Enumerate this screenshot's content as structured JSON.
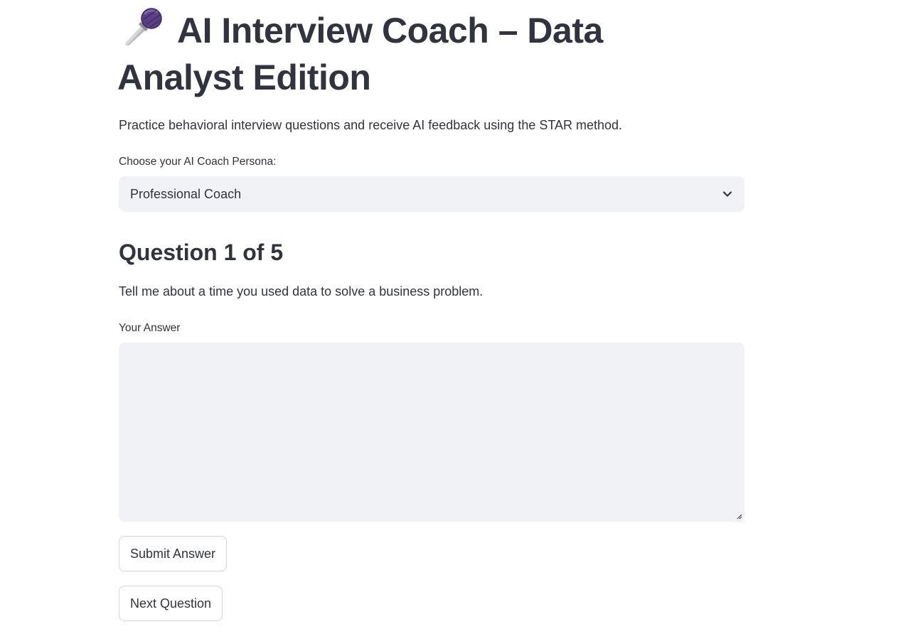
{
  "header": {
    "title": "AI Interview Coach – Data Analyst Edition",
    "title_icon": "microphone-icon"
  },
  "intro": {
    "subtitle": "Practice behavioral interview questions and receive AI feedback using the STAR method."
  },
  "persona": {
    "label": "Choose your AI Coach Persona:",
    "selected": "Professional Coach",
    "icon": "chevron-down-icon"
  },
  "question": {
    "heading": "Question 1 of 5",
    "text": "Tell me about a time you used data to solve a business problem."
  },
  "answer": {
    "label": "Your Answer",
    "value": "",
    "placeholder": ""
  },
  "actions": {
    "submit_label": "Submit Answer",
    "next_label": "Next Question"
  },
  "colors": {
    "text": "#31333f",
    "input_background": "#f0f2f6",
    "page_background": "#ffffff"
  }
}
